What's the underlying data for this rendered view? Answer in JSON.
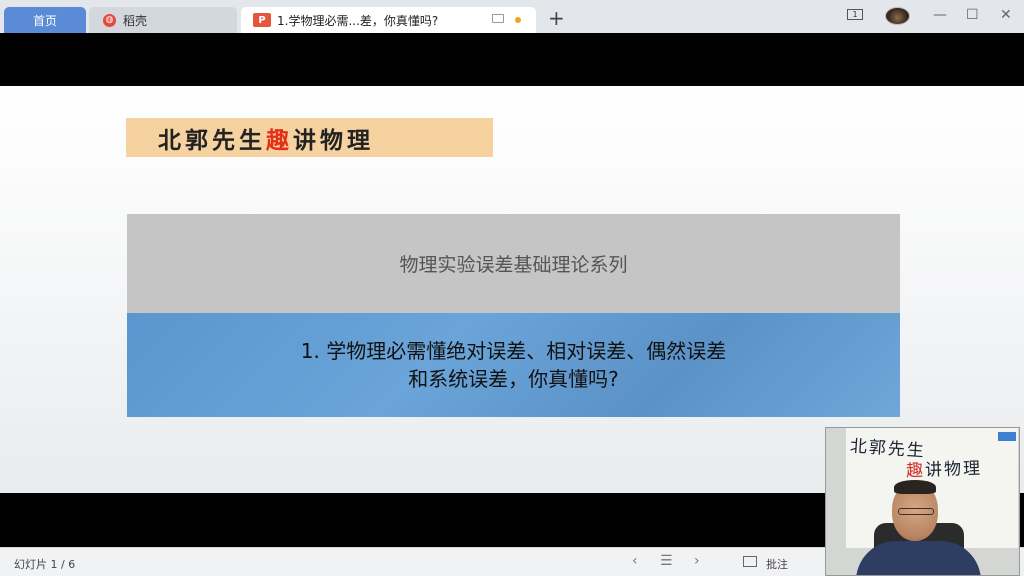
{
  "tabs": {
    "home": "首页",
    "daoke": "稻壳",
    "doc": "1.学物理必需...差，你真懂吗?",
    "new_tab": "+"
  },
  "window": {
    "book_icon_num": "1",
    "minimize": "—",
    "maximize": "☐",
    "close": "✕"
  },
  "slide": {
    "banner_pre": "北郭先生",
    "banner_red": "趣",
    "banner_post": "讲物理",
    "series_title": "物理实验误差基础理论系列",
    "lecture_line1": "1. 学物理必需懂绝对误差、相对误差、偶然误差",
    "lecture_line2": "和系统误差，你真懂吗?"
  },
  "statusbar": {
    "slide_counter": "幻灯片 1 / 6",
    "prev": "‹",
    "list": "☰",
    "next": "›",
    "comment_label": "批注"
  },
  "webcam": {
    "board_line1": "北郭先生",
    "board_line2_red": "趣",
    "board_line2": "讲物理"
  },
  "colors": {
    "banner_bg": "#f5d2a0",
    "banner_accent": "#e53019",
    "gray_box": "#c5c5c5",
    "blue_box": "#5a96cf",
    "home_tab": "#5b8bd6"
  }
}
